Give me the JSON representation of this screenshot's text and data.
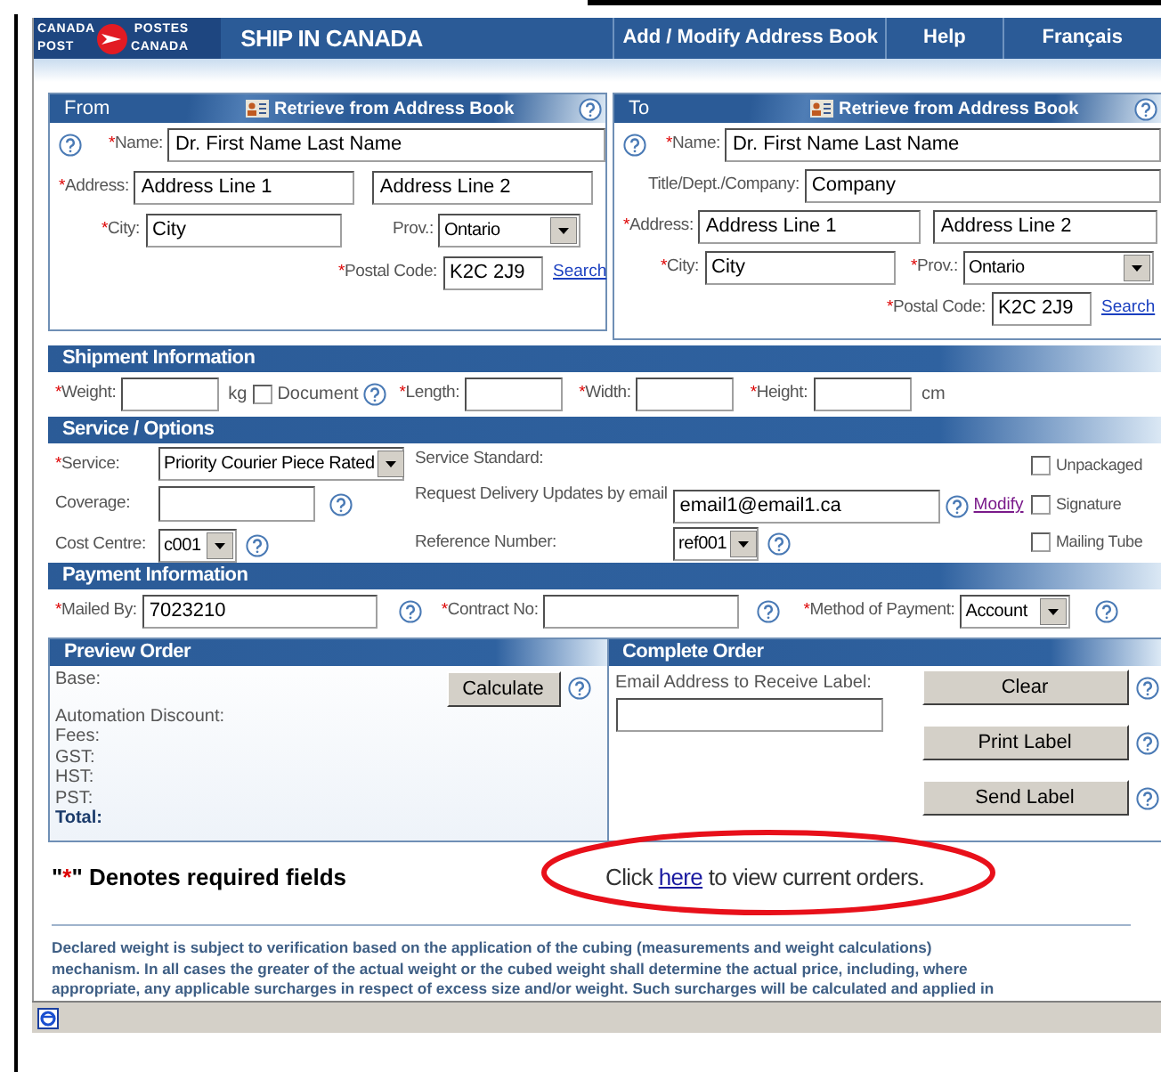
{
  "header": {
    "logo": {
      "top_left": "CANADA",
      "bottom_left": "POST",
      "top_right": "POSTES",
      "bottom_right": "CANADA"
    },
    "title": "SHIP IN CANADA",
    "nav": [
      {
        "label": "Add / Modify Address Book"
      },
      {
        "label": "Help"
      },
      {
        "label": "Français"
      }
    ]
  },
  "from": {
    "title": "From",
    "address_book_button": "Retrieve from Address Book",
    "name": {
      "mark": "*",
      "label": "Name:",
      "value": "Dr. First Name Last Name"
    },
    "address": {
      "mark": "*",
      "label": "Address:",
      "line_1": "Address Line 1",
      "line_2": "Address Line 2"
    },
    "city": {
      "mark": "*",
      "label": "City:",
      "value": "City"
    },
    "province": {
      "label": "Prov.:",
      "value": "Ontario"
    },
    "postal_code": {
      "mark": "*",
      "label": "Postal Code:",
      "value": "K2C 2J9"
    },
    "search_link": "Search"
  },
  "to": {
    "title": "To",
    "address_book_button": "Retrieve from Address Book",
    "name": {
      "mark": "*",
      "label": "Name:",
      "value": "Dr. First Name Last Name"
    },
    "company": {
      "label": "Title/Dept./Company:",
      "value": "Company"
    },
    "address": {
      "mark": "*",
      "label": "Address:",
      "line_1": "Address Line 1",
      "line_2": "Address Line 2"
    },
    "city": {
      "mark": "*",
      "label": "City:",
      "value": "City"
    },
    "province": {
      "mark": "*",
      "label": "Prov.:",
      "value": "Ontario"
    },
    "postal_code": {
      "mark": "*",
      "label": "Postal Code:",
      "value": "K2C 2J9"
    },
    "search_link": "Search"
  },
  "shipment": {
    "title": "Shipment Information",
    "weight": {
      "mark": "*",
      "label": "Weight:",
      "unit": "kg"
    },
    "document": {
      "label": "Document",
      "checked": false
    },
    "length": {
      "mark": "*",
      "label": "Length:"
    },
    "width": {
      "mark": "*",
      "label": "Width:"
    },
    "height": {
      "mark": "*",
      "label": "Height:",
      "unit": "cm"
    }
  },
  "service": {
    "title": "Service / Options",
    "service": {
      "mark": "*",
      "label": "Service:",
      "value": "Priority Courier Piece Rated"
    },
    "coverage": {
      "label": "Coverage:"
    },
    "cost_centre": {
      "label": "Cost Centre:",
      "value": "c001"
    },
    "service_standard": {
      "label": "Service Standard:"
    },
    "delivery_updates": {
      "label": "Request Delivery Updates by email",
      "value": "email1@email1.ca",
      "link": "Modify"
    },
    "reference_number": {
      "label": "Reference Number:",
      "value": "ref001"
    },
    "options": [
      {
        "label": "Unpackaged",
        "checked": false
      },
      {
        "label": "Signature",
        "checked": false
      },
      {
        "label": "Mailing Tube",
        "checked": false
      }
    ]
  },
  "payment": {
    "title": "Payment Information",
    "mailed_by": {
      "mark": "*",
      "label": "Mailed By:",
      "value": "7023210"
    },
    "contract_no": {
      "mark": "*",
      "label": "Contract No:"
    },
    "method": {
      "mark": "*",
      "label": "Method of Payment:",
      "value": "Account"
    }
  },
  "preview": {
    "title": "Preview Order",
    "base": "Base:",
    "calculate_button": "Calculate",
    "lines": [
      "Automation Discount:",
      "Fees:",
      "GST:",
      "HST:",
      "PST:"
    ],
    "total": "Total:"
  },
  "complete": {
    "title": "Complete Order",
    "email_label": "Email Address to Receive Label:",
    "buttons": [
      "Clear",
      "Print Label",
      "Send Label"
    ]
  },
  "footer": {
    "required_note": {
      "quote_open": "\"",
      "mark": "*",
      "text": "\" Denotes required fields"
    },
    "orders_note": {
      "before": "Click ",
      "link": "here",
      "after": " to view current orders."
    },
    "disclaimer": [
      "Declared weight is subject to verification based on the application of the cubing (measurements and weight calculations)",
      "mechanism. In all cases the greater of the actual weight or the cubed weight shall determine the actual price, including, where",
      "appropriate, any applicable surcharges in respect of excess size and/or weight. Such surcharges will be calculated and applied in"
    ]
  }
}
